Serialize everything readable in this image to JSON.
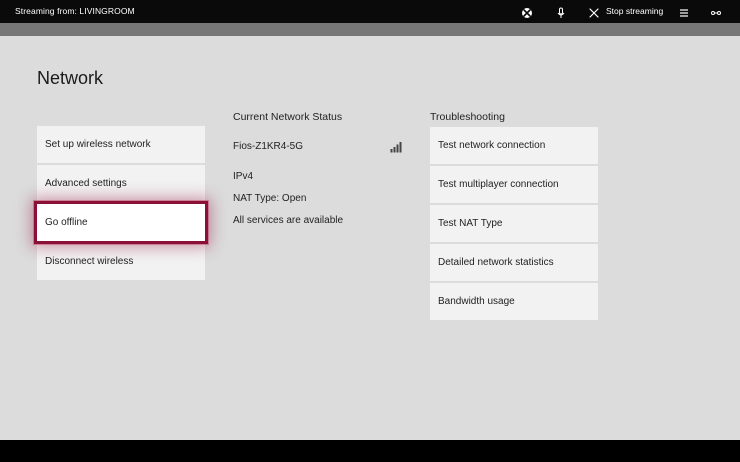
{
  "topbar": {
    "streaming_label": "Streaming from: LIVINGROOM",
    "stop_label": "Stop streaming",
    "icons": [
      "xbox-icon",
      "microphone-icon",
      "close-icon",
      "menu-icon",
      "connection-icon"
    ]
  },
  "page": {
    "title": "Network"
  },
  "menu": {
    "items": [
      {
        "label": "Set up wireless network"
      },
      {
        "label": "Advanced settings"
      },
      {
        "label": "Go offline"
      },
      {
        "label": "Disconnect wireless"
      }
    ],
    "selected": "Go offline"
  },
  "status": {
    "heading": "Current Network Status",
    "network_name": "Fios-Z1KR4-5G",
    "ip_version": "IPv4",
    "nat_type": "NAT Type: Open",
    "services": "All services are available"
  },
  "troubleshooting": {
    "heading": "Troubleshooting",
    "items": [
      {
        "label": "Test network connection"
      },
      {
        "label": "Test multiplayer connection"
      },
      {
        "label": "Test NAT Type"
      },
      {
        "label": "Detailed network statistics"
      },
      {
        "label": "Bandwidth usage"
      }
    ]
  },
  "colors": {
    "background": "#dcdcdc",
    "tile": "#f2f2f2",
    "focus": "#8a1038"
  }
}
